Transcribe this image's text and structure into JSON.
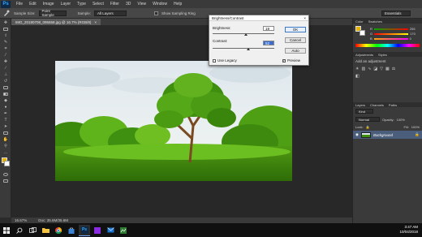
{
  "app": {
    "logo": "Ps"
  },
  "menu": [
    "File",
    "Edit",
    "Image",
    "Layer",
    "Type",
    "Select",
    "Filter",
    "3D",
    "View",
    "Window",
    "Help"
  ],
  "options": {
    "sample_size_label": "Sample Size:",
    "sample_size_value": "Point Sample",
    "sample_label": "Sample:",
    "sample_value": "All Layers",
    "show_ring_label": "Show Sampling Ring",
    "workspace_value": "Essentials"
  },
  "document_tab": {
    "title": "IMG_20180708_095658.jpg @ 16.7% (RGB/8)",
    "close": "×"
  },
  "status": {
    "zoom": "16.67%",
    "doc_size": "Doc: 35.6M/35.6M"
  },
  "dialog": {
    "title": "Brightness/Contrast",
    "close": "×",
    "brightness_label": "Brightness:",
    "brightness_value": "19",
    "brightness_fraction": 0.54,
    "contrast_label": "Contrast:",
    "contrast_value": "52",
    "contrast_fraction": 0.58,
    "ok": "OK",
    "cancel": "Cancel",
    "auto": "Auto",
    "use_legacy_label": "Use Legacy",
    "use_legacy_checked": false,
    "preview_label": "Preview",
    "preview_checked": true
  },
  "panels": {
    "color_tabs": [
      "Color",
      "Swatches"
    ],
    "color_sliders": [
      {
        "label": "R",
        "value": "255",
        "fraction": 1.0
      },
      {
        "label": "G",
        "value": "170",
        "fraction": 0.67
      },
      {
        "label": "B",
        "value": "0",
        "fraction": 0.0
      }
    ],
    "adjustments_tabs": [
      "Adjustments",
      "Styles"
    ],
    "adjustments_hint": "Add an adjustment",
    "layers_tabs": [
      "Layers",
      "Channels",
      "Paths"
    ],
    "layer_kind": "Kind",
    "blend_mode": "Normal",
    "opacity_label": "Opacity:",
    "opacity_value": "100%",
    "lock_label": "Lock:",
    "fill_label": "Fill:",
    "fill_value": "100%",
    "layer_name": "Background"
  },
  "clock": {
    "time": "3:47 AM",
    "date": "10/04/2018"
  },
  "colors": {
    "foreground": "#e6b400",
    "background": "#ffffff",
    "selection": "#4a5d7a"
  },
  "icons": [
    "windows-start-icon",
    "search-icon",
    "task-view-icon",
    "file-explorer-icon",
    "chrome-icon",
    "store-icon",
    "photoshop-icon",
    "app-icon",
    "mail-icon",
    "app-icon-2"
  ]
}
